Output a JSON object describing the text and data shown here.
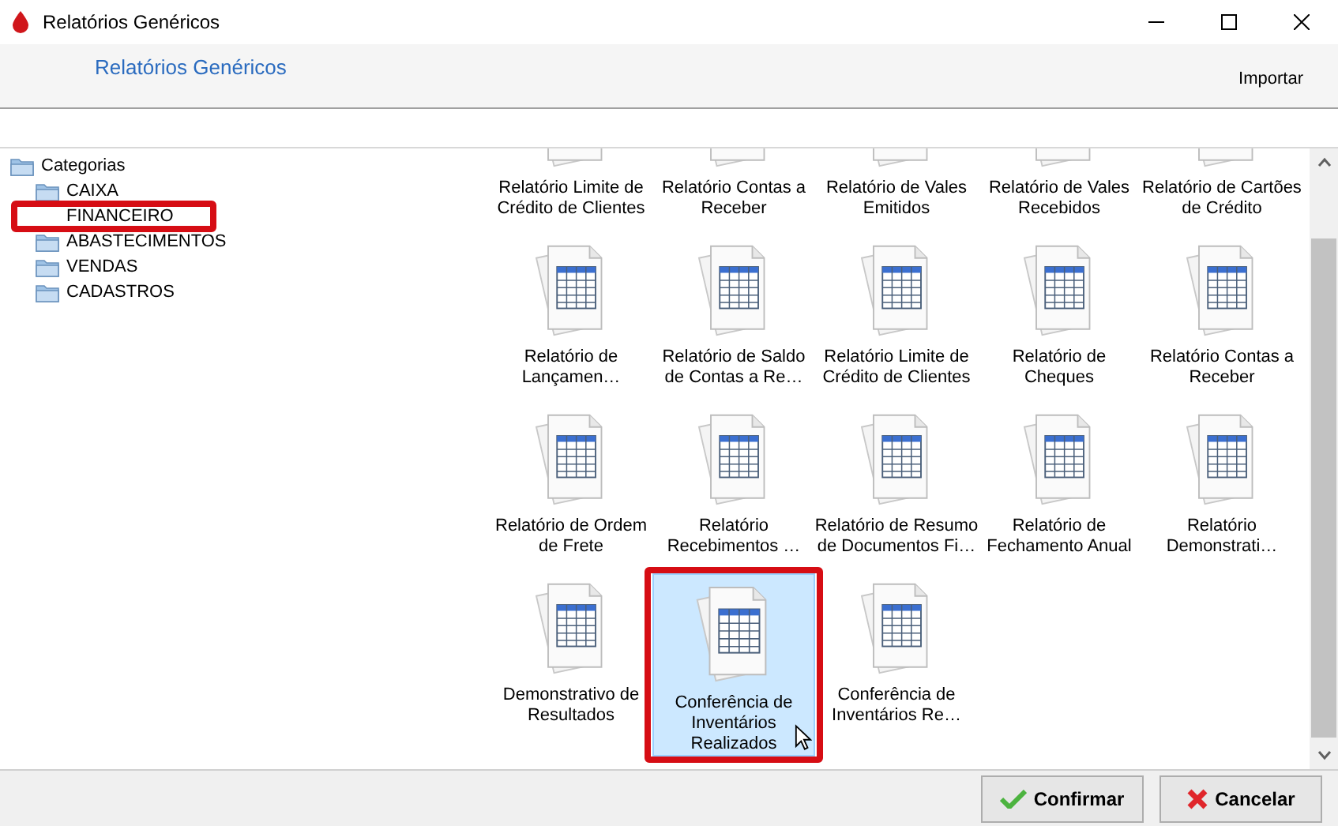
{
  "window": {
    "title": "Relatórios Genéricos"
  },
  "header": {
    "title": "Relatórios Genéricos",
    "action": "Importar"
  },
  "tree": {
    "label": "Categorias",
    "children": [
      {
        "label": "CAIXA",
        "highlighted": false
      },
      {
        "label": "FINANCEIRO",
        "highlighted": true
      },
      {
        "label": "ABASTECIMENTOS",
        "highlighted": false
      },
      {
        "label": "VENDAS",
        "highlighted": false
      },
      {
        "label": "CADASTROS",
        "highlighted": false
      }
    ]
  },
  "reports": [
    {
      "label": "Relatório Limite de Crédito de Clientes",
      "selected": false
    },
    {
      "label": "Relatório Contas a Receber",
      "selected": false
    },
    {
      "label": "Relatório de Vales Emitidos",
      "selected": false
    },
    {
      "label": "Relatório de Vales Recebidos",
      "selected": false
    },
    {
      "label": "Relatório de Cartões de Crédito",
      "selected": false
    },
    {
      "label": "Relatório de Lançamen…",
      "selected": false
    },
    {
      "label": "Relatório de Saldo de Contas a Re…",
      "selected": false
    },
    {
      "label": "Relatório Limite de Crédito de Clientes",
      "selected": false
    },
    {
      "label": "Relatório de Cheques",
      "selected": false
    },
    {
      "label": "Relatório Contas a Receber",
      "selected": false
    },
    {
      "label": "Relatório de Ordem de Frete",
      "selected": false
    },
    {
      "label": "Relatório Recebimentos …",
      "selected": false
    },
    {
      "label": "Relatório de Resumo de Documentos Fi…",
      "selected": false
    },
    {
      "label": "Relatório de Fechamento Anual",
      "selected": false
    },
    {
      "label": "Relatório Demonstrati…",
      "selected": false
    },
    {
      "label": "Demonstrativo de Resultados",
      "selected": false
    },
    {
      "label": "Conferência de Inventários Realizados",
      "selected": true
    },
    {
      "label": "Conferência de Inventários Re…",
      "selected": false
    }
  ],
  "buttons": [
    {
      "kind": "confirm",
      "label": "Confirmar"
    },
    {
      "kind": "cancel",
      "label": "Cancelar"
    }
  ]
}
